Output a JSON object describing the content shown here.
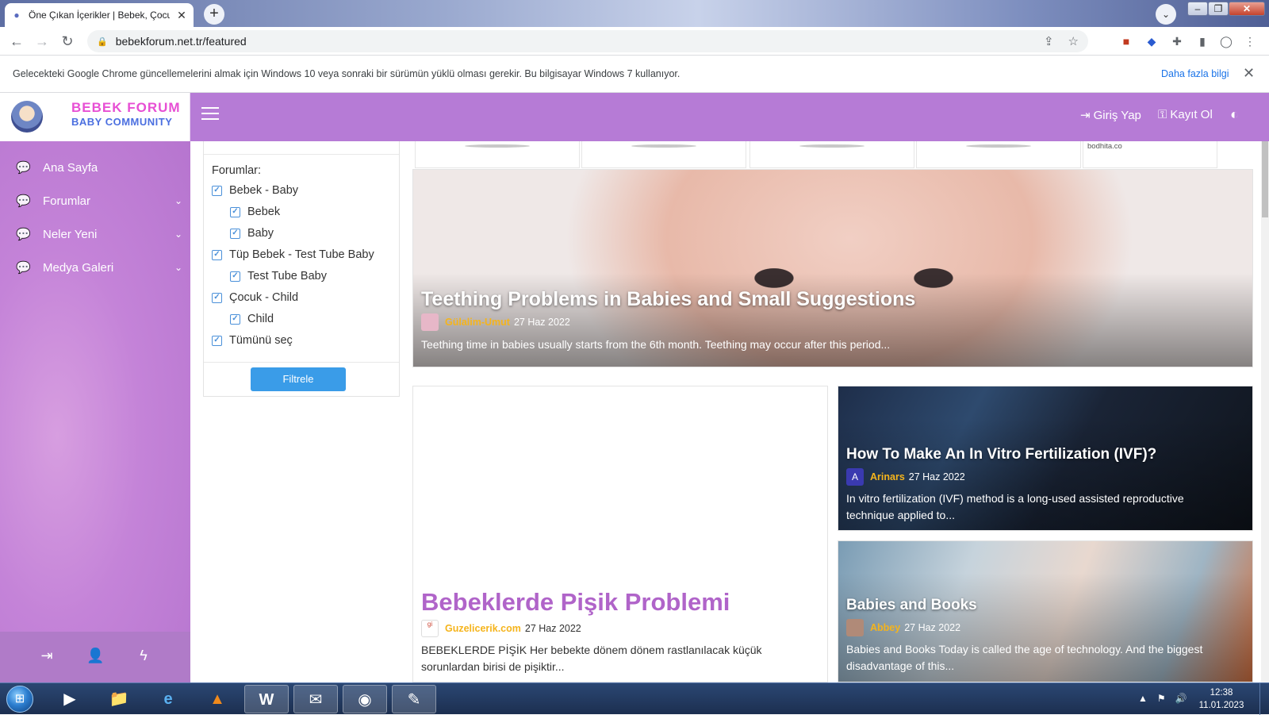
{
  "browser": {
    "tab_title": "Öne Çıkan İçerikler | Bebek, Çocu",
    "url": "bebekforum.net.tr/featured",
    "infobar_message": "Gelecekteki Google Chrome güncellemelerini almak için Windows 10 veya sonraki bir sürümün yüklü olması gerekir. Bu bilgisayar Windows 7 kullanıyor.",
    "infobar_link": "Daha fazla bilgi"
  },
  "site": {
    "logo_line1": "BEBEK FORUM",
    "logo_line2": "BABY COMMUNITY",
    "login": "Giriş Yap",
    "register": "Kayıt Ol"
  },
  "sidebar": {
    "items": [
      {
        "label": "Ana Sayfa",
        "has_submenu": false
      },
      {
        "label": "Forumlar",
        "has_submenu": true
      },
      {
        "label": "Neler Yeni",
        "has_submenu": true
      },
      {
        "label": "Medya Galeri",
        "has_submenu": true
      }
    ]
  },
  "filter": {
    "label": "Forumlar:",
    "options": [
      {
        "label": "Bebek - Baby",
        "checked": true,
        "level": 0
      },
      {
        "label": "Bebek",
        "checked": true,
        "level": 1
      },
      {
        "label": "Baby",
        "checked": true,
        "level": 1
      },
      {
        "label": "Tüp Bebek - Test Tube Baby",
        "checked": true,
        "level": 0
      },
      {
        "label": "Test Tube Baby",
        "checked": true,
        "level": 1
      },
      {
        "label": "Çocuk - Child",
        "checked": true,
        "level": 0
      },
      {
        "label": "Child",
        "checked": true,
        "level": 1
      },
      {
        "label": "Tümünü seç",
        "checked": true,
        "level": 0
      }
    ],
    "button": "Filtrele"
  },
  "ad_strip": {
    "source": "bodhita.co"
  },
  "cards": {
    "hero": {
      "title": "Teething Problems in Babies and Small Suggestions",
      "author": "Gülalim-Umut",
      "date": "27 Haz 2022",
      "excerpt": "Teething time in babies usually starts from the 6th month. Teething may occur after this period..."
    },
    "pisik": {
      "title": "Bebeklerde Pişik Problemi",
      "author": "Guzelicerik.com",
      "date": "27 Haz 2022",
      "excerpt": "BEBEKLERDE PİŞİK Her bebekte dönem dönem rastlanılacak küçük sorunlardan birisi de pişiktir..."
    },
    "ivf": {
      "title": "How To Make An In Vitro Fertilization (IVF)?",
      "author": "Arinars",
      "avatar_letter": "A",
      "date": "27 Haz 2022",
      "excerpt": "In vitro fertilization (IVF) method is a long-used assisted reproductive technique applied to..."
    },
    "books": {
      "title": "Babies and Books",
      "author": "Abbey",
      "date": "27 Haz 2022",
      "excerpt": "Babies and Books Today is called the age of technology. And the biggest disadvantage of this..."
    }
  },
  "taskbar": {
    "time": "12:38",
    "date": "11.01.2023"
  }
}
